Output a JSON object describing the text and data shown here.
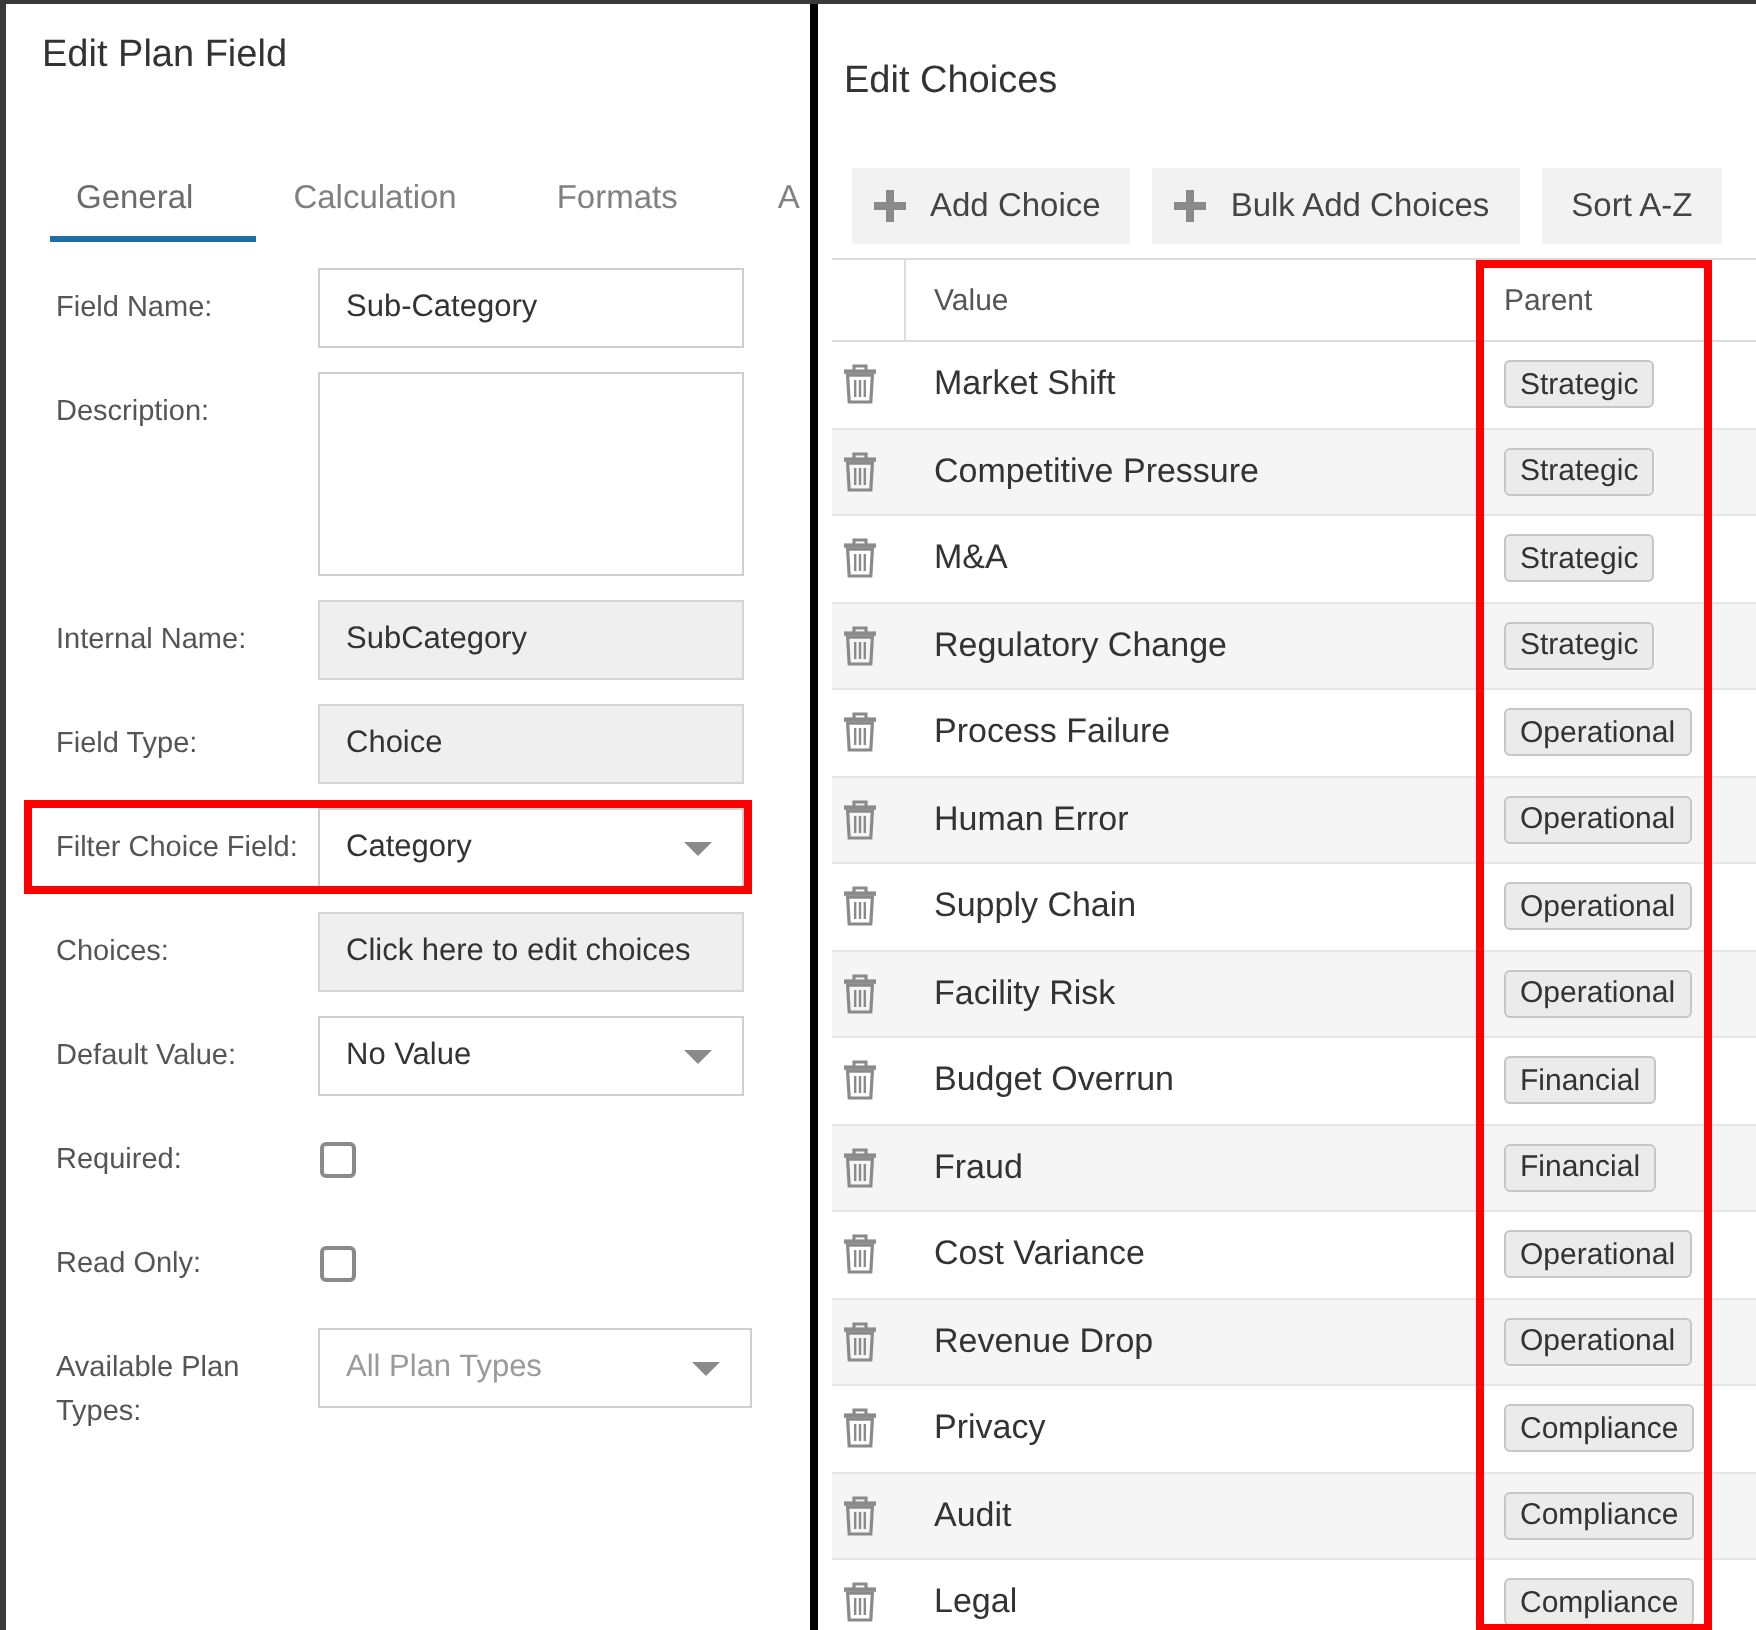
{
  "left_dialog": {
    "title": "Edit Plan Field",
    "tabs": [
      {
        "label": "General",
        "selected": true
      },
      {
        "label": "Calculation",
        "selected": false
      },
      {
        "label": "Formats",
        "selected": false
      },
      {
        "label": "A",
        "selected": false
      }
    ],
    "fields": [
      {
        "label": "Field Name:",
        "kind": "text",
        "value": "Sub-Category",
        "highlighted": false
      },
      {
        "label": "Description:",
        "kind": "textarea",
        "highlighted": false
      },
      {
        "label": "Internal Name:",
        "kind": "readonly",
        "value": "SubCategory",
        "highlighted": false
      },
      {
        "label": "Field Type:",
        "kind": "readonly",
        "value": "Choice",
        "highlighted": false
      },
      {
        "label": "Filter Choice Field:",
        "kind": "select",
        "value": "Category",
        "highlighted": true
      },
      {
        "label": "Choices:",
        "kind": "link",
        "value": "Click here to edit choices",
        "highlighted": false
      },
      {
        "label": "Default Value:",
        "kind": "select",
        "value": "No Value",
        "highlighted": false
      },
      {
        "label": "Required:",
        "kind": "checkbox",
        "checked": false,
        "highlighted": false
      },
      {
        "label": "Read Only:",
        "kind": "checkbox",
        "checked": false,
        "highlighted": false
      },
      {
        "label": "Available Plan Types:",
        "kind": "multiselect",
        "placeholder": "All Plan Types",
        "highlighted": false
      }
    ]
  },
  "right_dialog": {
    "title": "Edit Choices",
    "toolbar": [
      {
        "label": "Add Choice",
        "kind": "add"
      },
      {
        "label": "Bulk Add Choices",
        "kind": "add"
      },
      {
        "label": "Sort A-Z",
        "kind": "plain"
      }
    ],
    "table": {
      "columns": [
        {
          "label": "Value",
          "highlighted": false
        },
        {
          "label": "Parent",
          "highlighted": true
        }
      ],
      "rows": [
        {
          "value": "Market Shift",
          "parent": "Strategic"
        },
        {
          "value": "Competitive Pressure",
          "parent": "Strategic"
        },
        {
          "value": "M&A",
          "parent": "Strategic"
        },
        {
          "value": "Regulatory Change",
          "parent": "Strategic"
        },
        {
          "value": "Process Failure",
          "parent": "Operational"
        },
        {
          "value": "Human Error",
          "parent": "Operational"
        },
        {
          "value": "Supply Chain",
          "parent": "Operational"
        },
        {
          "value": "Facility Risk",
          "parent": "Operational"
        },
        {
          "value": "Budget Overrun",
          "parent": "Financial"
        },
        {
          "value": "Fraud",
          "parent": "Financial"
        },
        {
          "value": "Cost Variance",
          "parent": "Operational"
        },
        {
          "value": "Revenue Drop",
          "parent": "Operational"
        },
        {
          "value": "Privacy",
          "parent": "Compliance"
        },
        {
          "value": "Audit",
          "parent": "Compliance"
        },
        {
          "value": "Legal",
          "parent": "Compliance"
        }
      ]
    }
  }
}
